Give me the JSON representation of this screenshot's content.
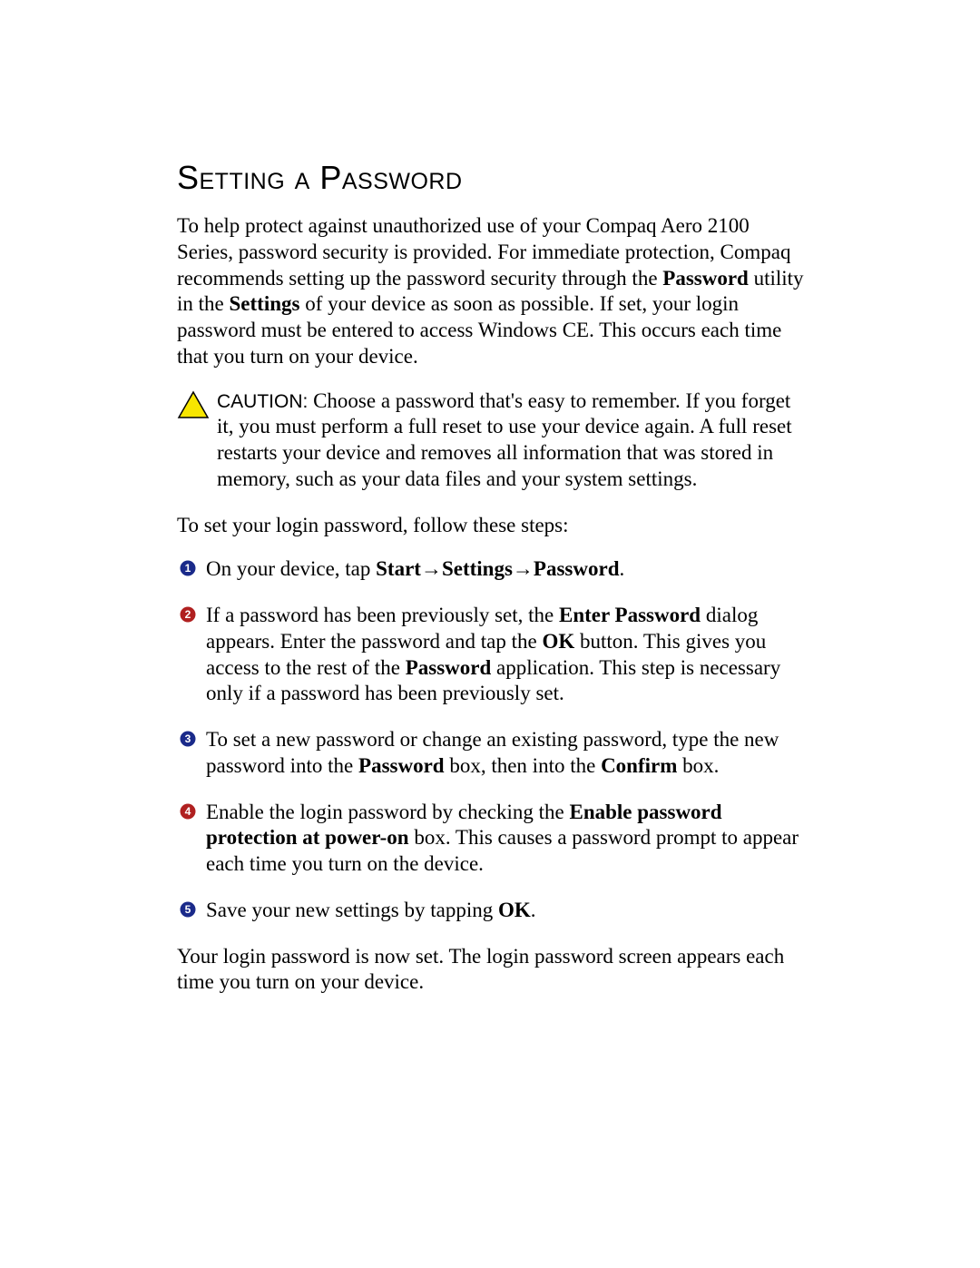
{
  "heading": "Setting a Password",
  "intro": {
    "t1": "To help protect against unauthorized use of your Compaq Aero 2100 Series, password security is provided. For immediate protection, Compaq recommends setting up the password security through the ",
    "b1": "Password",
    "t2": " utility in the ",
    "b2": "Settings",
    "t3": " of your device as soon as possible. If set, your login password must be entered to access Windows CE. This occurs each time that you turn on your device."
  },
  "caution": {
    "label": "CAUTION:",
    "text": " Choose a password that's easy to remember. If you forget it, you must perform a full reset to use your device again. A full reset restarts your device and removes all information that was stored in memory, such as your data files and your system settings."
  },
  "steps_intro": "To set your login password, follow these steps:",
  "bullets": {
    "color_a": "#1a2a8a",
    "color_b": "#b02020"
  },
  "steps": [
    {
      "parts": [
        {
          "t": "On your device, tap "
        },
        {
          "b": "Start"
        },
        {
          "a": "→"
        },
        {
          "b": "Settings"
        },
        {
          "a": "→"
        },
        {
          "b": "Password"
        },
        {
          "t": "."
        }
      ]
    },
    {
      "parts": [
        {
          "t": "If a password has been previously set, the "
        },
        {
          "b": "Enter Password"
        },
        {
          "t": " dialog appears. Enter the password and tap the "
        },
        {
          "b": "OK"
        },
        {
          "t": " button. This gives you access to the rest of the "
        },
        {
          "b": "Password"
        },
        {
          "t": " application. This step is necessary only if a password has been previously set."
        }
      ]
    },
    {
      "parts": [
        {
          "t": "To set a new password or change an existing password, type the new password into the "
        },
        {
          "b": "Password"
        },
        {
          "t": " box, then into the "
        },
        {
          "b": "Confirm"
        },
        {
          "t": " box."
        }
      ]
    },
    {
      "parts": [
        {
          "t": "Enable the login password by checking the "
        },
        {
          "b": "Enable password protection at power-on"
        },
        {
          "t": " box. This causes a password prompt to appear each time you turn on the device."
        }
      ]
    },
    {
      "parts": [
        {
          "t": "Save your new settings by tapping "
        },
        {
          "b": "OK"
        },
        {
          "t": "."
        }
      ]
    }
  ],
  "closing": "Your login password is now set. The login password screen appears each time you turn on your device."
}
